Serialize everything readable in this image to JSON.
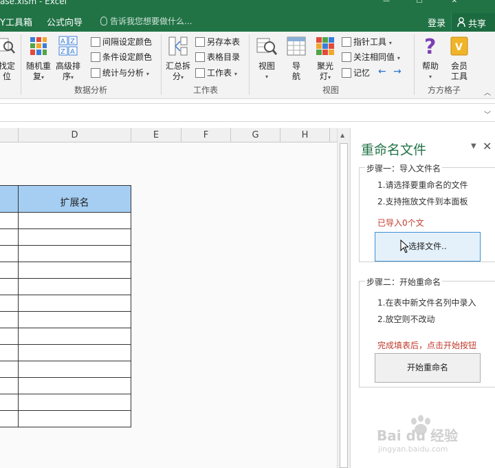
{
  "window": {
    "title": "ase.xlsm - Excel",
    "colors": {
      "brand": "#217346",
      "accent": "#a5cef2",
      "status_red": "#c0392b"
    }
  },
  "menu": {
    "tabs": [
      "Y工具箱",
      "公式向导"
    ],
    "tellme_placeholder": "告诉我您想要做什么...",
    "login": "登录",
    "share": "共享"
  },
  "ribbon": {
    "partial_left": [
      "找定",
      "位"
    ],
    "groups": {
      "data_analysis": {
        "label": "数据分析",
        "random_repeat": [
          "随机重",
          "复"
        ],
        "advanced_sort": [
          "高级排",
          "序"
        ],
        "interval_color": "间隔设定颜色",
        "condition_color": "条件设定颜色",
        "stats_analysis": "统计与分析"
      },
      "worksheet": {
        "label": "工作表",
        "summary_split": [
          "汇总拆",
          "分"
        ],
        "save_this": "另存本表",
        "table_index": "表格目录",
        "worksheet": "工作表"
      },
      "view": {
        "label": "视图",
        "view": "视图",
        "navigate": [
          "导",
          "航"
        ],
        "focus_light": [
          "聚光",
          "灯"
        ],
        "pointer_tool": "指针工具",
        "focus_same": "关注相同值",
        "memory": "记忆"
      },
      "fangfang": {
        "label": "方方格子",
        "help": "帮助",
        "member_tool": [
          "会员",
          "工具"
        ]
      }
    }
  },
  "sheet": {
    "columns": [
      "D",
      "E",
      "F",
      "G",
      "H"
    ],
    "table_header_ext": "扩展名",
    "row_count": 13
  },
  "pane": {
    "title": "重命名文件",
    "step1": {
      "title": "步骤一：导入文件名",
      "line1": "1.请选择要重命名的文件",
      "line2": "2.支持拖放文件到本面板",
      "status": "已导入0个文",
      "button": "选择文件.."
    },
    "step2": {
      "title": "步骤二：开始重命名",
      "line1": "1.在表中新文件名列中录入",
      "line2": "2.放空则不改动",
      "status": "完成填表后，点击开始按钮",
      "button": "开始重命名"
    }
  },
  "watermark": {
    "brand": "Bai du 经验",
    "url": "jingyan.baidu.com"
  }
}
